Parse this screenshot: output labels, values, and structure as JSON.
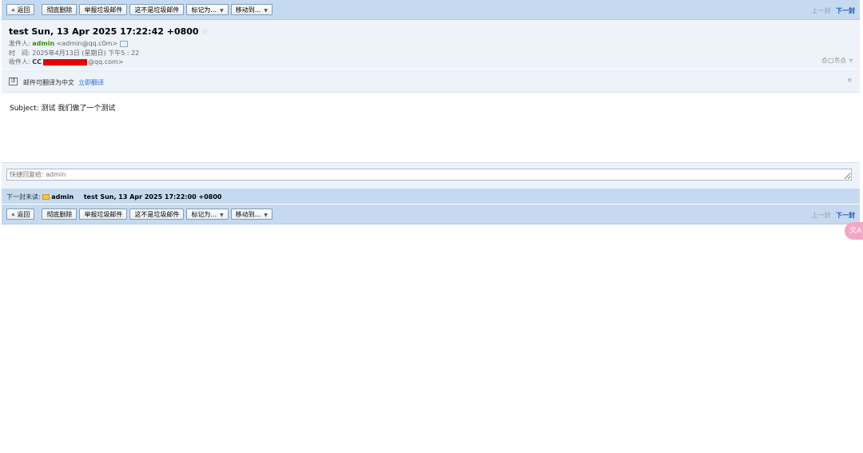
{
  "toolbar": {
    "back": "« 返回",
    "delete": "彻底删除",
    "report_spam": "举报垃圾邮件",
    "not_spam": "这不是垃圾邮件",
    "mark_as": "标记为...",
    "move_to": "移动到...",
    "prev": "上一封",
    "next": "下一封"
  },
  "mail": {
    "subject": "test Sun, 13 Apr 2025 17:22:42 +0800",
    "from_label": "发件人:",
    "from_name": "admin",
    "from_addr": "<admin@qq.c0m>",
    "time_label": "时　间:",
    "time_value": "2025年4月13日 (星期日) 下午5 : 22",
    "to_label": "收件人:",
    "to_prefix": "CC",
    "to_suffix": "@qq.com>",
    "tools": "⎙▢⎘⎙ ▿"
  },
  "translate": {
    "icon": "译",
    "text": "邮件可翻译为中文",
    "link": "立即翻译",
    "close": "×"
  },
  "body": {
    "text": "Subject: 测试 我们做了一个测试"
  },
  "quick_reply": {
    "placeholder": "快捷回复给: admin"
  },
  "next_unread": {
    "label": "下一封未读:",
    "sender": "admin",
    "subject": "test Sun, 13 Apr 2025 17:22:00 +0800"
  },
  "side_badge": "文A"
}
